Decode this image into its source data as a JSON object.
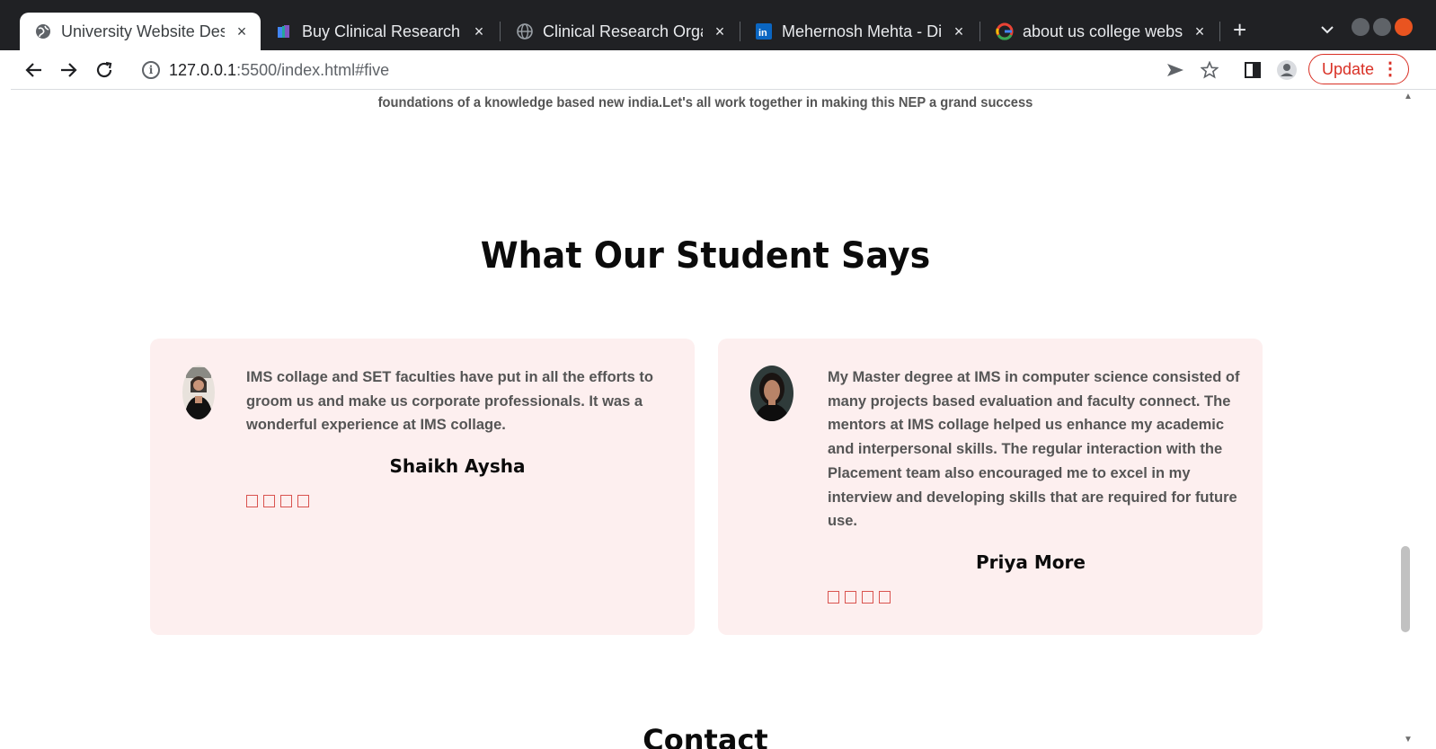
{
  "browser": {
    "tabs": [
      {
        "title": "University Website Des",
        "favicon": "globe-icon",
        "active": true
      },
      {
        "title": "Buy Clinical Research C",
        "favicon": "book-icon",
        "active": false
      },
      {
        "title": "Clinical Research Orga",
        "favicon": "globe-icon",
        "active": false
      },
      {
        "title": "Mehernosh Mehta - Dir",
        "favicon": "linkedin-icon",
        "active": false
      },
      {
        "title": "about us college websi",
        "favicon": "google-icon",
        "active": false
      }
    ],
    "close_glyph": "×",
    "new_tab_glyph": "+",
    "url_host": "127.0.0.1",
    "url_path": ":5500/index.html#five",
    "update_label": "Update"
  },
  "page": {
    "intro_line": "foundations of a knowledge based new india.Let's all work together in making this NEP a grand success",
    "section_title": "What Our Student Says",
    "testimonials": [
      {
        "text": "IMS collage and SET faculties have put in all the efforts to groom us and make us corporate professionals. It was a wonderful experience at IMS collage.",
        "name": "Shaikh Aysha",
        "stars": 4
      },
      {
        "text": "My Master degree at IMS in computer science consisted of many projects based evaluation and faculty connect. The mentors at IMS collage helped us enhance my academic and interpersonal skills. The regular interaction with the Placement team also encouraged me to excel in my interview and developing skills that are required for future use.",
        "name": "Priya More",
        "stars": 4
      }
    ],
    "next_section_title": "Contact"
  },
  "colors": {
    "card_bg": "#fdefef",
    "star_outline": "#d9534f",
    "update_red": "#d93025",
    "tab_bar": "#202124"
  }
}
